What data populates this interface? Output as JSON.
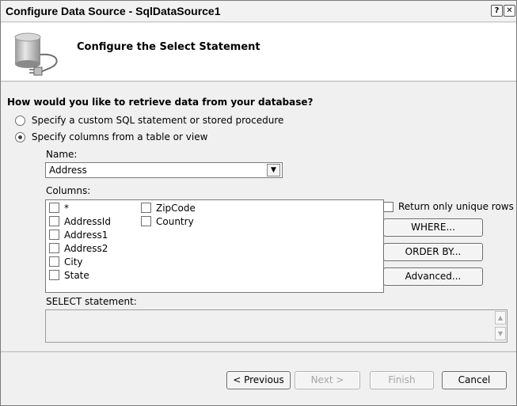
{
  "window": {
    "title": "Configure Data Source - SqlDataSource1",
    "help_glyph": "?",
    "close_glyph": "✕"
  },
  "header": {
    "heading": "Configure the Select Statement",
    "icon": "database-icon"
  },
  "form": {
    "question": "How would you like to retrieve data from your database?",
    "option_custom": "Specify a custom SQL statement or stored procedure",
    "option_columns": "Specify columns from a table or view",
    "selected_option": "option_columns",
    "name_label": "Name:",
    "name_value": "Address",
    "columns_label": "Columns:",
    "columns": [
      "*",
      "AddressId",
      "Address1",
      "Address2",
      "City",
      "State"
    ],
    "columns_right": [
      "ZipCode",
      "Country"
    ],
    "return_unique_label": "Return only unique rows",
    "where_button": "WHERE...",
    "orderby_button": "ORDER BY...",
    "advanced_button": "Advanced...",
    "select_statement_label": "SELECT statement:",
    "select_statement_value": ""
  },
  "footer": {
    "previous": "< Previous",
    "next": "Next >",
    "finish": "Finish",
    "cancel": "Cancel"
  }
}
